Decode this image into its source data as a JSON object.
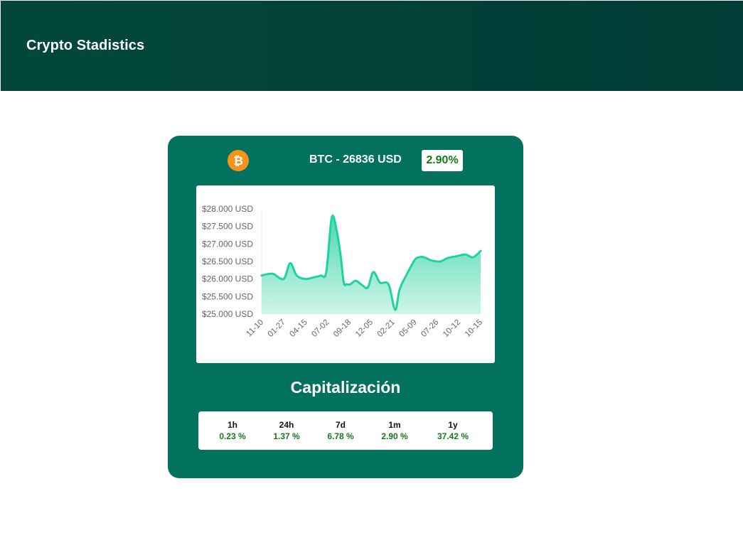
{
  "header": {
    "title": "Crypto Stadistics"
  },
  "coin": {
    "icon": "bitcoin-icon",
    "price_label": "BTC - 26836 USD",
    "change": "2.90%",
    "change_color": "#157a1c"
  },
  "colors": {
    "header_bg": "#00403a",
    "card_bg": "#02715e",
    "line": "#1ed39f",
    "area_top": "#3fd7a9",
    "area_bottom": "#c9f3e6",
    "positive": "#157a1c",
    "bitcoin_orange": "#f7931a"
  },
  "chart_data": {
    "type": "area",
    "xlabel": "",
    "ylabel": "",
    "ylim": [
      25000,
      28000
    ],
    "y_ticks": [
      "$28.000 USD",
      "$27.500 USD",
      "$27.000 USD",
      "$26.500 USD",
      "$26.000 USD",
      "$25.500 USD",
      "$25.000 USD"
    ],
    "x_ticks": [
      "11-10",
      "01-27",
      "04-15",
      "07-02",
      "09-18",
      "12-05",
      "02-21",
      "05-09",
      "07-26",
      "10-12",
      "10-15"
    ],
    "grid": false,
    "legend": "none",
    "x_index": [
      0,
      0.5,
      1.0,
      1.3,
      1.6,
      2.0,
      2.4,
      2.7,
      2.95,
      3.2,
      3.42,
      3.6,
      3.75,
      3.88,
      4.05,
      4.3,
      4.6,
      4.85,
      5.1,
      5.4,
      5.7,
      5.85,
      6.1,
      6.3,
      6.6,
      7.0,
      7.2,
      7.35,
      7.5,
      7.75,
      8.15,
      8.5,
      8.9,
      9.3,
      9.65,
      10.0
    ],
    "values": [
      26100,
      26150,
      26000,
      26450,
      26100,
      26000,
      26050,
      26100,
      26200,
      27750,
      27400,
      26700,
      25900,
      25850,
      25850,
      25950,
      25820,
      25760,
      26200,
      25900,
      25900,
      25750,
      25120,
      25700,
      26100,
      26550,
      26620,
      26630,
      26600,
      26530,
      26500,
      26600,
      26650,
      26700,
      26620,
      26800
    ],
    "values_note": "",
    "series": [
      {
        "name": "",
        "color": "#1ed39f"
      }
    ]
  },
  "capitalization": {
    "title": "Capitalización",
    "items": [
      {
        "label": "1h",
        "value": "0.23 %"
      },
      {
        "label": "24h",
        "value": "1.37 %"
      },
      {
        "label": "7d",
        "value": "6.78 %"
      },
      {
        "label": "1m",
        "value": "2.90 %"
      },
      {
        "label": "1y",
        "value": "37.42 %"
      }
    ]
  }
}
